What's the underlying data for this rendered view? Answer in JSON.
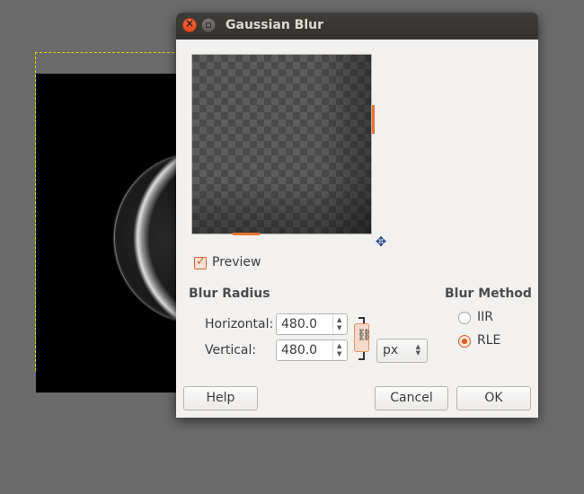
{
  "dialog": {
    "title": "Gaussian Blur",
    "preview_label": "Preview",
    "preview_checked": true,
    "blur_radius": {
      "title": "Blur Radius",
      "horizontal_label": "Horizontal:",
      "horizontal_value": "480.0",
      "vertical_label": "Vertical:",
      "vertical_value": "480.0",
      "unit": "px",
      "chain_linked": true
    },
    "blur_method": {
      "title": "Blur Method",
      "options": [
        "IIR",
        "RLE"
      ],
      "selected": "RLE"
    },
    "buttons": {
      "help": "Help",
      "cancel": "Cancel",
      "ok": "OK"
    }
  },
  "colors": {
    "accent": "#e8732f",
    "titlebar": "#3a3834",
    "dialog_bg": "#f2f1f0",
    "workspace_bg": "#6b6b6b",
    "selection_border": "#e5d400"
  },
  "icons": {
    "close": "close-icon",
    "minimize": "minimize-icon",
    "navigate": "move-arrows-icon",
    "chain": "chain-link-icon"
  }
}
